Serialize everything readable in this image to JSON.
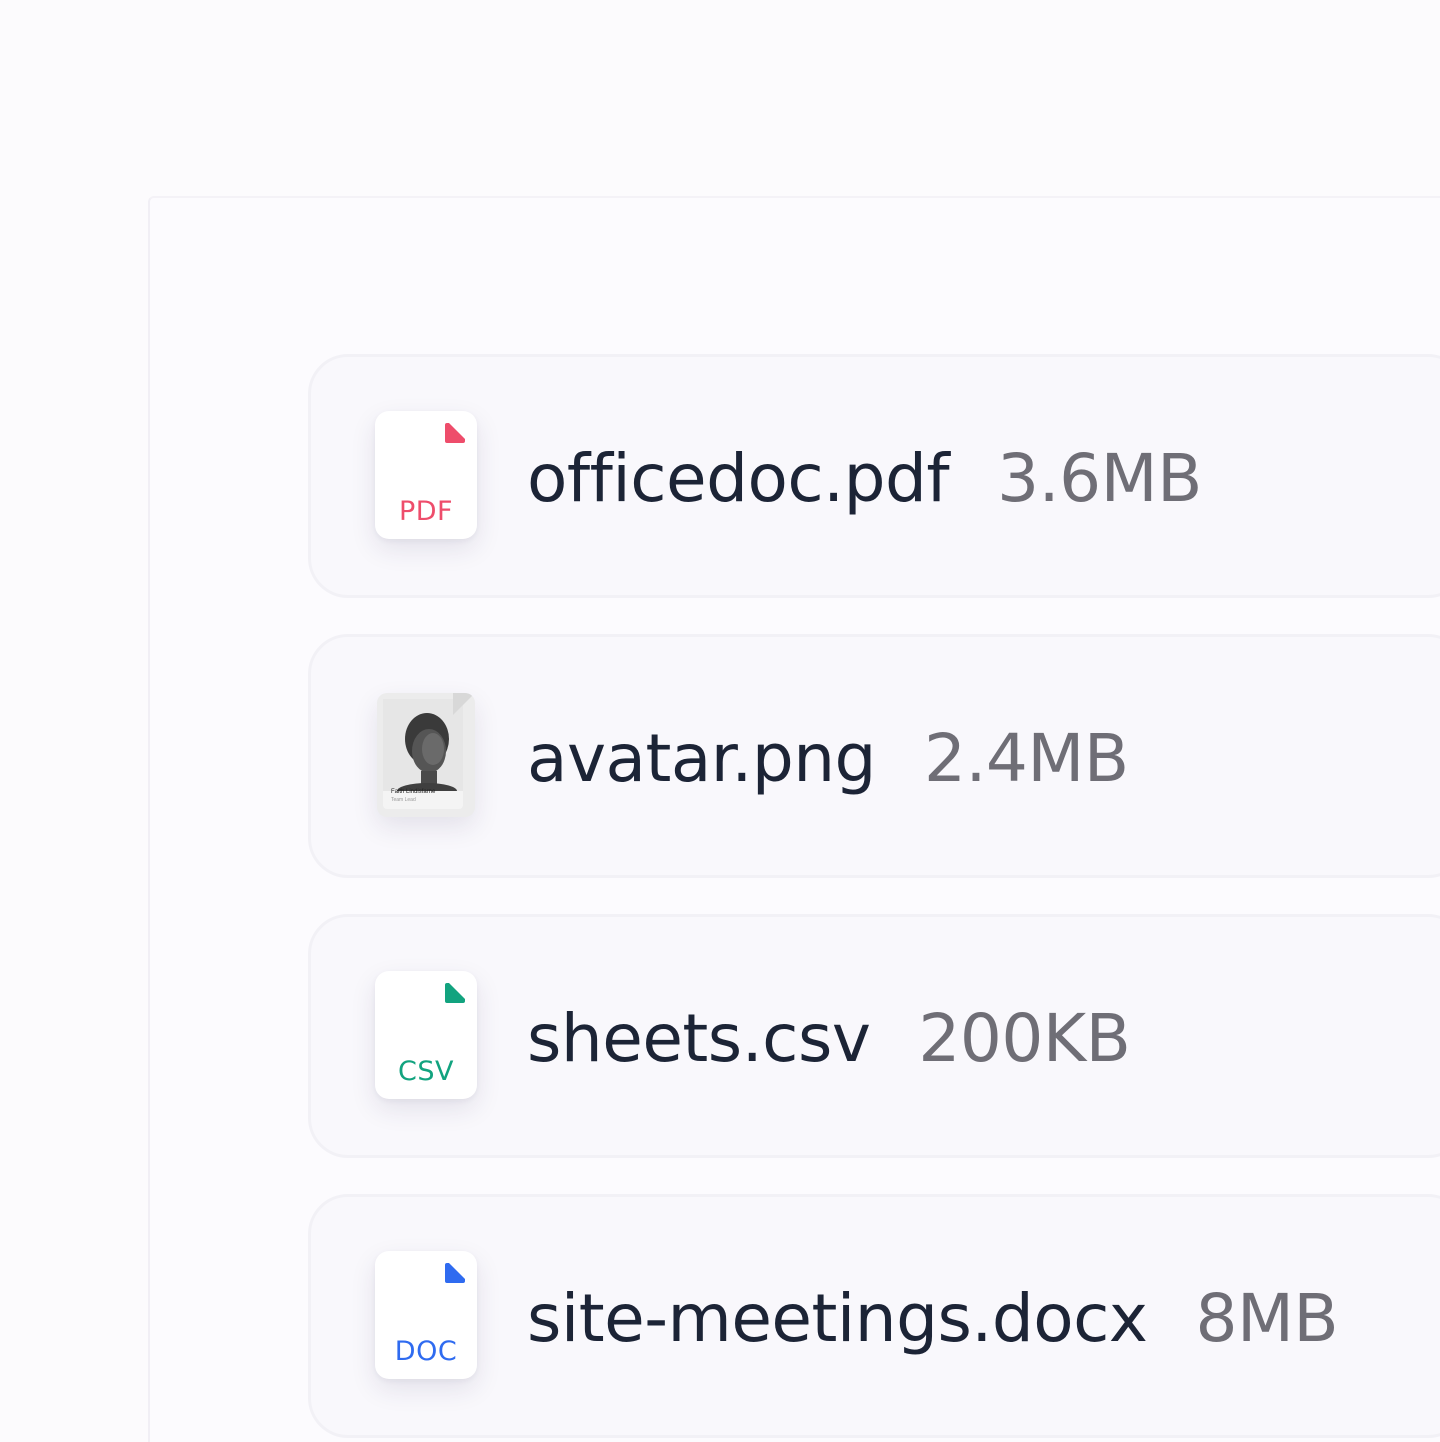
{
  "files": [
    {
      "name": "officedoc.pdf",
      "size": "3.6MB",
      "type": "PDF",
      "color": "#ee4d6b",
      "icon": "pdf-file-icon"
    },
    {
      "name": "avatar.png",
      "size": "2.4MB",
      "type": "image",
      "icon": "image-file-icon",
      "thumbnail": {
        "caption_name": "Faith Lindisfarne",
        "caption_role": "Team Lead"
      }
    },
    {
      "name": "sheets.csv",
      "size": "200KB",
      "type": "CSV",
      "color": "#12a37f",
      "icon": "csv-file-icon"
    },
    {
      "name": "site-meetings.docx",
      "size": "8MB",
      "type": "DOC",
      "color": "#2f6bf0",
      "icon": "doc-file-icon"
    }
  ]
}
